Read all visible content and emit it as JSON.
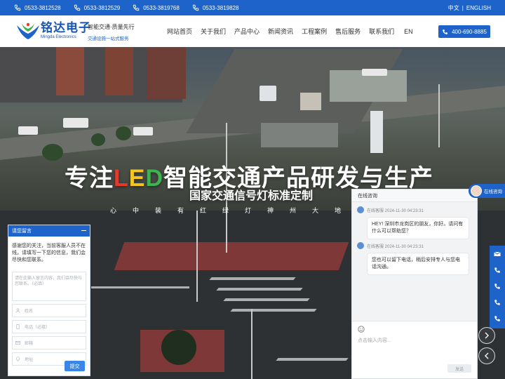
{
  "topbar": {
    "phones": [
      "0533-3812528",
      "0533-3812529",
      "0533-3819768",
      "0533-3819828"
    ],
    "lang_cn": "中文",
    "lang_sep": "|",
    "lang_en": "ENGLISH"
  },
  "header": {
    "brand_cn": "铭达电子",
    "brand_en": "Mingda Electronics",
    "slogan_1": "智能交通·质量先行",
    "slogan_2": "交通设施一站式服务",
    "nav": [
      "网站首页",
      "关于我们",
      "产品中心",
      "新闻资讯",
      "工程案例",
      "售后服务",
      "联系我们",
      "EN"
    ],
    "hotline": "400-690-8885"
  },
  "hero": {
    "headline_pre": "专注",
    "led_l": "L",
    "led_e": "E",
    "led_d": "D",
    "headline_post": "智能交通产品研发与生产",
    "subline": "国家交通信号灯标准定制",
    "tagline": "心中装有红绿灯神州大地陆"
  },
  "message_box": {
    "title": "请您留言",
    "description": "感谢您的关注，当前客服人员不在线，请填写一下您的信息，我们会尽快和您联系。",
    "content_placeholder": "请在此输入留言内容，我们会尽快与您联系。（必填）",
    "fields": [
      "姓名",
      "电话（必填）",
      "邮箱",
      "地址"
    ],
    "submit": "提交"
  },
  "chat": {
    "title": "在线咨询",
    "messages": [
      {
        "sender": "在线客服 2024-11-30 04:23:31",
        "text": "HEY! 深圳市龙岗区的朋友，你好。请问有什么可以帮助您？"
      },
      {
        "sender": "在线客服 2024-11-30 04:23:31",
        "text": "您也可以留下电话，稍后安排专人与您电话沟通。"
      }
    ],
    "input_placeholder": "点击输入内容...",
    "send": "发送",
    "emoji_icon": "emoji-icon"
  },
  "float": {
    "consult": "在线咨询"
  },
  "colors": {
    "primary": "#1e63c9",
    "led_red": "#e53b2c",
    "led_yellow": "#f3c623",
    "led_green": "#3fb34f"
  }
}
